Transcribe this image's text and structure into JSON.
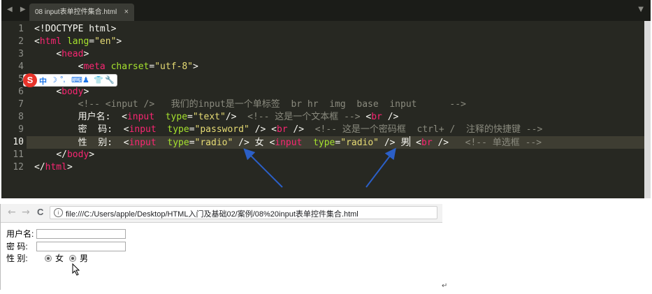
{
  "editor": {
    "tab_title": "08 input表单控件集合.html",
    "tab_close": "×",
    "nav_arrows": "◀ ▶",
    "tab_dropdown": "▼",
    "line_numbers": [
      "1",
      "2",
      "3",
      "4",
      "5",
      "6",
      "7",
      "8",
      "9",
      "10",
      "11",
      "12"
    ],
    "active_line": "10",
    "lines": {
      "l1": "<!DOCTYPE html>",
      "l2_open": "<",
      "l2_tag": "html",
      "l2_attr": " lang",
      "l2_eq": "=",
      "l2_val": "\"en\"",
      "l2_close": ">",
      "l3_indent": "    ",
      "l3_open": "<",
      "l3_tag": "head",
      "l3_close": ">",
      "l4_indent": "        ",
      "l4_open": "<",
      "l4_tag": "meta",
      "l4_attr": " charset",
      "l4_eq": "=",
      "l4_val": "\"utf-8\"",
      "l4_close": ">",
      "l6_indent": "    ",
      "l6_open": "<",
      "l6_tag": "body",
      "l6_close": ">",
      "l7": "        <!-- <input />   我们的input是一个单标签  br hr  img  base  input      -->",
      "l8_label": "        用户名:  ",
      "l8_open": "<",
      "l8_tag": "input",
      "l8_attr": "  type",
      "l8_eq": "=",
      "l8_val": "\"text\"",
      "l8_close": "/>",
      "l8_comment": "  <!-- 这是一个文本框 --> ",
      "l8_br_open": "<",
      "l8_br_tag": "br",
      "l8_br_close": " />",
      "l9_label": "        密  码:  ",
      "l9_open": "<",
      "l9_tag": "input",
      "l9_attr": "  type",
      "l9_eq": "=",
      "l9_val": "\"password\"",
      "l9_close": " /> ",
      "l9_br_open": "<",
      "l9_br_tag": "br",
      "l9_br_close": " />",
      "l9_comment": "  <!-- 这是一个密码框  ctrl+ /  注释的快捷键 -->",
      "l10_label": "        性  别:  ",
      "l10_open": "<",
      "l10_tag": "input",
      "l10_attr": "  type",
      "l10_eq": "=",
      "l10_val": "\"radio\"",
      "l10_close": " /> ",
      "l10_word1": "女 ",
      "l10_open2": "<",
      "l10_tag2": "input",
      "l10_attr2": "  type",
      "l10_eq2": "=",
      "l10_val2": "\"radio\"",
      "l10_close2": " /> ",
      "l10_word2": "男",
      "l10_br_open": " <",
      "l10_br_tag": "br",
      "l10_br_close": " />",
      "l10_comment": "   <!-- 单选框 -->",
      "l11_indent": "    ",
      "l11_open": "</",
      "l11_tag": "body",
      "l11_close": ">",
      "l12_open": "</",
      "l12_tag": "html",
      "l12_close": ">"
    },
    "ime_toolbar": {
      "logo": "S",
      "mode": "中",
      "items": [
        "☽",
        "°,",
        "⌨",
        "♟",
        "👕",
        "🔧"
      ]
    },
    "colors": {
      "background": "#272822",
      "tag": "#f92672",
      "attr": "#a6e22e",
      "string": "#e6db74",
      "comment": "#8a8a7e",
      "arrow": "#2b5fc7"
    }
  },
  "browser": {
    "back": "←",
    "forward": "→",
    "reload": "C",
    "info_icon": "i",
    "url": "file:///C:/Users/apple/Desktop/HTML入门及基础02/案例/08%20input表单控件集合.html",
    "form": {
      "username_label": "用户名:",
      "password_label": "密   码:",
      "gender_label": "性   别:",
      "female": "女",
      "male": "男"
    }
  },
  "pilcrow": "↵"
}
